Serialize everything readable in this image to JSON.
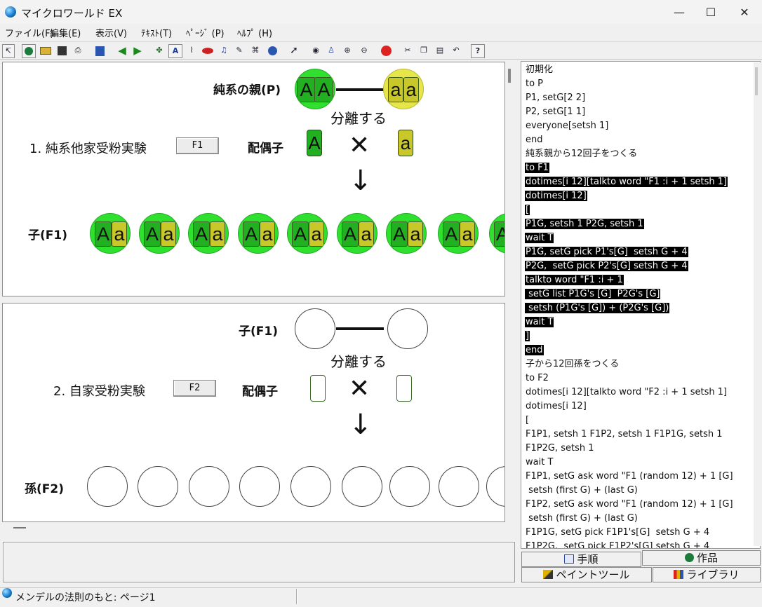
{
  "window": {
    "title": "マイクロワールド EX",
    "minimize": "—",
    "maximize": "☐",
    "close": "✕"
  },
  "menu": [
    "ファイル(F)",
    "編集(E)",
    "表示(V)",
    "ﾃｷｽﾄ(T)",
    "ﾍﾟｰｼﾞ (P)",
    "ﾍﾙﾌﾟ (H)"
  ],
  "toolbar": {
    "icons": [
      "pointer-small-icon",
      "globe-icon",
      "open-folder-icon",
      "save-disk-icon",
      "print-icon",
      "pages-icon",
      "arrow-left-icon",
      "arrow-right-icon",
      "turtle-hatch-icon",
      "text-box-icon",
      "paint-icon",
      "eye-box-icon",
      "music-note-icon",
      "pen-icon",
      "movie-icon",
      "globe-small-icon",
      "cursor-icon",
      "eye-icon",
      "stamp-icon",
      "zoom-in-icon",
      "zoom-out-icon",
      "hand-stop-icon",
      "scissors-icon",
      "copy-icon",
      "paste-icon",
      "undo-icon",
      "help-icon"
    ],
    "help_label": "?"
  },
  "pane1": {
    "parent_label": "純系の親(P)",
    "parent_left": [
      "A",
      "A"
    ],
    "parent_right": [
      "a",
      "a"
    ],
    "separate_label": "分離する",
    "experiment_label": "1. 純系他家受粉実験",
    "button_label": "F1",
    "gamete_label": "配偶子",
    "gamete_left": "A",
    "cross": "✕",
    "gamete_right": "a",
    "arrow": "↓",
    "child_label": "子(F1)",
    "children": [
      {
        "big": "A",
        "small": "a"
      },
      {
        "big": "A",
        "small": "a"
      },
      {
        "big": "A",
        "small": "a"
      },
      {
        "big": "A",
        "small": "a"
      },
      {
        "big": "A",
        "small": "a"
      },
      {
        "big": "A",
        "small": "a"
      },
      {
        "big": "A",
        "small": "a"
      },
      {
        "big": "A",
        "small": "a"
      },
      {
        "big": "A",
        "small": ""
      }
    ]
  },
  "pane2": {
    "parent_label": "子(F1)",
    "separate_label": "分離する",
    "experiment_label": "2. 自家受粉実験",
    "button_label": "F2",
    "gamete_label": "配偶子",
    "cross": "✕",
    "arrow": "↓",
    "grandchild_label": "孫(F2)"
  },
  "code": [
    {
      "t": "初期化",
      "h": false
    },
    {
      "t": "to P",
      "h": false
    },
    {
      "t": "P1, setG[2 2]",
      "h": false
    },
    {
      "t": "P2, setG[1 1]",
      "h": false
    },
    {
      "t": "everyone[setsh 1]",
      "h": false
    },
    {
      "t": "end",
      "h": false
    },
    {
      "t": "純系親から12回子をつくる",
      "h": false
    },
    {
      "t": "to F1",
      "h": true
    },
    {
      "t": "dotimes[i 12][talkto word \"F1 :i + 1 setsh 1]",
      "h": true
    },
    {
      "t": "dotimes[i 12]",
      "h": true
    },
    {
      "t": "[",
      "h": true
    },
    {
      "t": "P1G, setsh 1 P2G, setsh 1",
      "h": true
    },
    {
      "t": "wait T",
      "h": true
    },
    {
      "t": "P1G, setG pick P1's[G]  setsh G + 4",
      "h": true
    },
    {
      "t": "P2G,  setG pick P2's[G] setsh G + 4",
      "h": true
    },
    {
      "t": "talkto word \"F1 :i + 1",
      "h": true
    },
    {
      "t": " setG list P1G's [G]  P2G's [G]",
      "h": true
    },
    {
      "t": " setsh (P1G's [G]) + (P2G's [G])",
      "h": true
    },
    {
      "t": "wait T",
      "h": true
    },
    {
      "t": "]",
      "h": true
    },
    {
      "t": "end",
      "h": true
    },
    {
      "t": "子から12回孫をつくる",
      "h": false
    },
    {
      "t": "to F2",
      "h": false
    },
    {
      "t": "dotimes[i 12][talkto word \"F2 :i + 1 setsh 1]",
      "h": false
    },
    {
      "t": "dotimes[i 12]",
      "h": false
    },
    {
      "t": "[",
      "h": false
    },
    {
      "t": "F1P1, setsh 1 F1P2, setsh 1 F1P1G, setsh 1",
      "h": false
    },
    {
      "t": "F1P2G, setsh 1",
      "h": false
    },
    {
      "t": "wait T",
      "h": false
    },
    {
      "t": "F1P1, setG ask word \"F1 (random 12) + 1 [G]",
      "h": false
    },
    {
      "t": " setsh (first G) + (last G)",
      "h": false
    },
    {
      "t": "F1P2, setG ask word \"F1 (random 12) + 1 [G]",
      "h": false
    },
    {
      "t": " setsh (first G) + (last G)",
      "h": false
    },
    {
      "t": "F1P1G, setG pick F1P1's[G]  setsh G + 4",
      "h": false
    },
    {
      "t": "F1P2G,  setG pick F1P2's[G] setsh G + 4",
      "h": false
    }
  ],
  "tabs": {
    "procedures": "手順",
    "works": "作品",
    "paint_tool": "ペイントツール",
    "library": "ライブラリ"
  },
  "status": {
    "text": "メンデルの法則のもと: ページ1"
  }
}
